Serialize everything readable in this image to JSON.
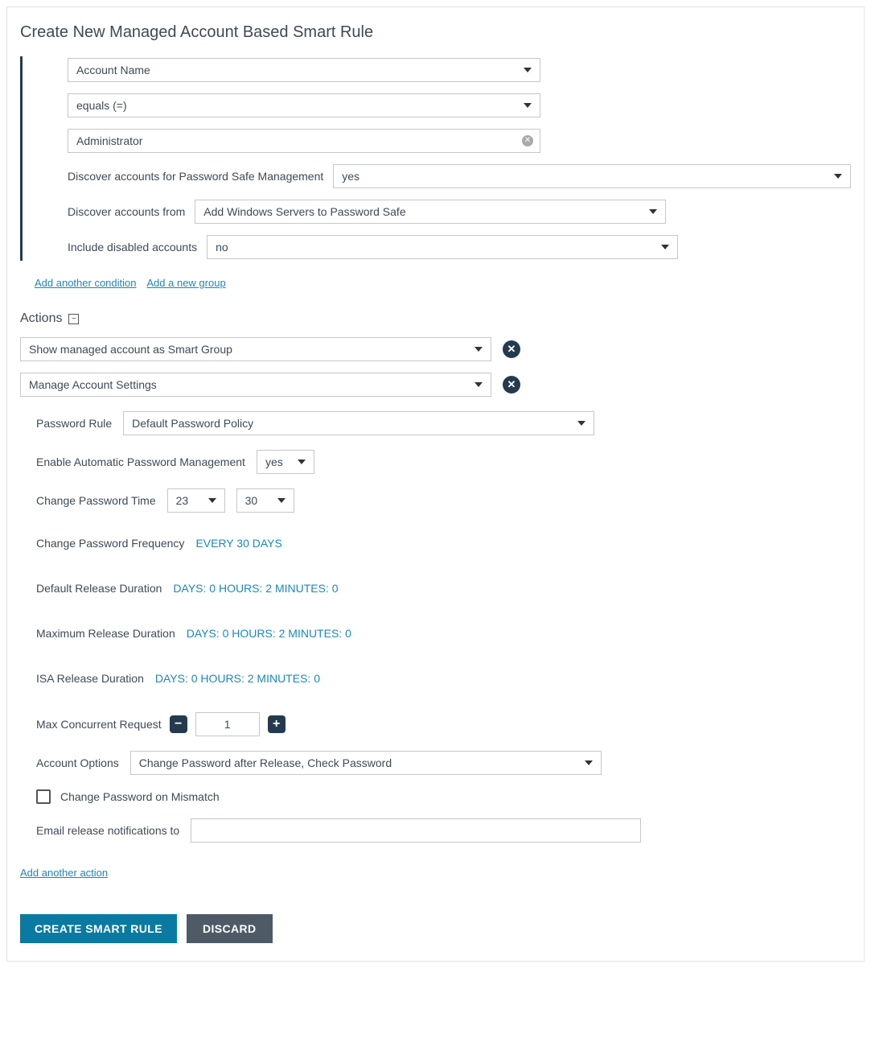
{
  "title": "Create New Managed Account Based Smart Rule",
  "condition": {
    "field": "Account Name",
    "operator": "equals (=)",
    "value": "Administrator",
    "discover_ps_label": "Discover accounts for Password Safe Management",
    "discover_ps_value": "yes",
    "discover_from_label": "Discover accounts from",
    "discover_from_value": "Add Windows Servers to Password Safe",
    "include_disabled_label": "Include disabled accounts",
    "include_disabled_value": "no"
  },
  "links": {
    "add_condition": "Add another condition",
    "add_group": "Add a new group",
    "add_action": "Add another action"
  },
  "actions_header": "Actions",
  "actions": [
    {
      "label": "Show managed account as Smart Group"
    },
    {
      "label": "Manage Account Settings"
    }
  ],
  "settings": {
    "password_rule_label": "Password Rule",
    "password_rule_value": "Default Password Policy",
    "auto_pwd_label": "Enable Automatic Password Management",
    "auto_pwd_value": "yes",
    "change_time_label": "Change Password Time",
    "change_time_hour": "23",
    "change_time_minute": "30",
    "change_freq_label": "Change Password Frequency",
    "change_freq_value": "EVERY 30 DAYS",
    "default_release_label": "Default Release Duration",
    "default_release_value": "DAYS: 0 HOURS: 2 MINUTES: 0",
    "max_release_label": "Maximum Release Duration",
    "max_release_value": "DAYS: 0 HOURS: 2 MINUTES: 0",
    "isa_release_label": "ISA Release Duration",
    "isa_release_value": "DAYS: 0 HOURS: 2 MINUTES: 0",
    "max_concurrent_label": "Max Concurrent Request",
    "max_concurrent_value": "1",
    "account_options_label": "Account Options",
    "account_options_value": "Change Password after Release, Check Password",
    "mismatch_label": "Change Password on Mismatch",
    "email_label": "Email release notifications to"
  },
  "buttons": {
    "create": "CREATE SMART RULE",
    "discard": "DISCARD"
  }
}
